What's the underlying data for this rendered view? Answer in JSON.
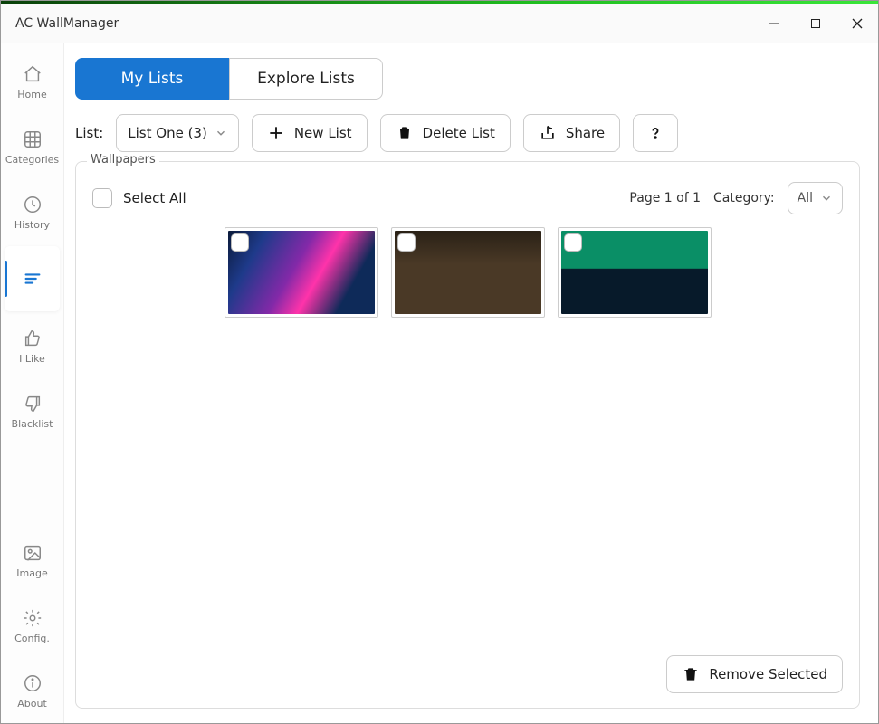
{
  "window": {
    "title": "AC WallManager"
  },
  "sidebar": {
    "home": "Home",
    "categories": "Categories",
    "history": "History",
    "ilike": "I Like",
    "blacklist": "Blacklist",
    "image": "Image",
    "config": "Config.",
    "about": "About"
  },
  "tabs": {
    "mylists": "My Lists",
    "explore": "Explore Lists"
  },
  "toolbar": {
    "list_label": "List:",
    "list_selected": "List One (3)",
    "new_list": "New List",
    "delete_list": "Delete List",
    "share": "Share"
  },
  "panel": {
    "legend": "Wallpapers",
    "select_all": "Select All",
    "page_text": "Page 1 of 1",
    "category_label": "Category:",
    "category_selected": "All",
    "remove_selected": "Remove Selected"
  }
}
